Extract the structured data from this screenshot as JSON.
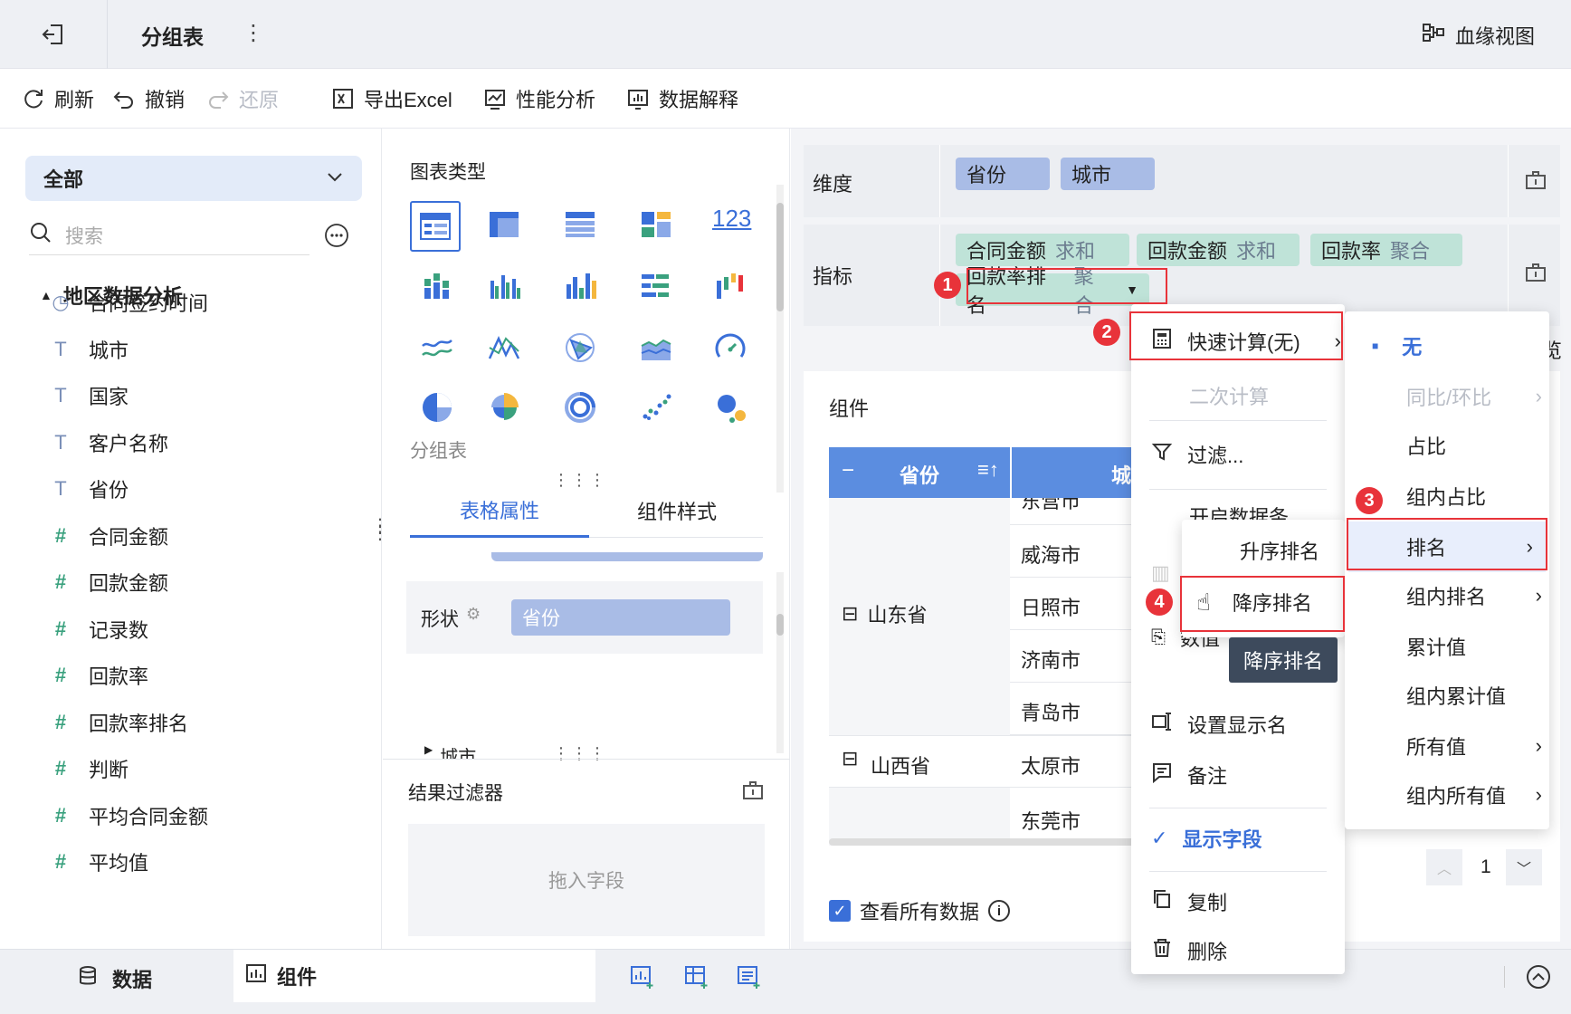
{
  "header": {
    "title": "分组表",
    "lineage_label": "血缘视图"
  },
  "toolbar": {
    "refresh": "刷新",
    "undo": "撤销",
    "redo": "还原",
    "export": "导出Excel",
    "perf": "性能分析",
    "explain": "数据解释"
  },
  "left": {
    "scope": "全部",
    "search_placeholder": "搜索",
    "group": "地区数据分析",
    "fields": [
      {
        "label": "合同签约时间",
        "icon": "clock-icon"
      },
      {
        "label": "城市",
        "icon": "text-type-icon"
      },
      {
        "label": "国家",
        "icon": "text-type-icon"
      },
      {
        "label": "客户名称",
        "icon": "text-type-icon"
      },
      {
        "label": "省份",
        "icon": "text-type-icon"
      },
      {
        "label": "合同金额",
        "icon": "number-type-icon"
      },
      {
        "label": "回款金额",
        "icon": "number-type-icon"
      },
      {
        "label": "记录数",
        "icon": "number-type-icon"
      },
      {
        "label": "回款率",
        "icon": "calc-number-icon"
      },
      {
        "label": "回款率排名",
        "icon": "calc-number-icon"
      },
      {
        "label": "判断",
        "icon": "calc-number-icon"
      },
      {
        "label": "平均合同金额",
        "icon": "calc-number-icon"
      },
      {
        "label": "平均值",
        "icon": "calc-number-icon"
      }
    ]
  },
  "mid": {
    "chart_type_title": "图表类型",
    "number_icon_text": "123",
    "current_type": "分组表",
    "tabs": [
      "表格属性",
      "组件样式"
    ],
    "shape_label": "形状",
    "shape_value": "省份",
    "city_node": "城市",
    "result_filter": "结果过滤器",
    "drop_hint": "拖入字段"
  },
  "right": {
    "dimension_label": "维度",
    "dimensions": [
      "省份",
      "城市"
    ],
    "metric_label": "指标",
    "metrics": [
      {
        "name": "合同金额",
        "agg": "求和"
      },
      {
        "name": "回款金额",
        "agg": "求和"
      },
      {
        "name": "回款率",
        "agg": "聚合"
      },
      {
        "name": "回款率排名",
        "agg": "聚合"
      }
    ],
    "component_label": "组件",
    "table_header": {
      "col1": "省份",
      "col2": "城"
    },
    "rows": [
      {
        "province": "",
        "city": "东营市"
      },
      {
        "province": "",
        "city": "威海市"
      },
      {
        "province": "山东省",
        "city": "日照市"
      },
      {
        "province": "",
        "city": "济南市"
      },
      {
        "province": "",
        "city": "青岛市"
      },
      {
        "province": "山西省",
        "city": "太原市"
      },
      {
        "province": "",
        "city": "东莞市"
      }
    ],
    "view_all": "查看所有数据",
    "page": "1",
    "preview_char": "览"
  },
  "menu1": {
    "quick_calc": "快速计算(无)",
    "secondary_calc": "二次计算",
    "filter": "过滤...",
    "hidden_item": "开启数据条",
    "value_item": "数值",
    "set_display_name": "设置显示名",
    "remark": "备注",
    "show_field": "显示字段",
    "copy": "复制",
    "delete": "删除"
  },
  "menu2": {
    "none": "无",
    "yoy": "同比/环比",
    "ratio": "占比",
    "group_ratio": "组内占比",
    "rank": "排名",
    "group_rank": "组内排名",
    "cumulative": "累计值",
    "group_cumulative": "组内累计值",
    "all_values": "所有值",
    "group_all_values": "组内所有值"
  },
  "menu3": {
    "asc": "升序排名",
    "desc": "降序排名",
    "tooltip": "降序排名"
  },
  "badges": [
    "1",
    "2",
    "3",
    "4"
  ],
  "bottom": {
    "data_tab": "数据",
    "component_tab": "组件"
  },
  "colors": {
    "accent": "#3a6fd8",
    "blue_pill": "#a9bce6",
    "green_pill": "#bfe3d8",
    "badge": "#e8333a",
    "table_header": "#5b8de0"
  }
}
